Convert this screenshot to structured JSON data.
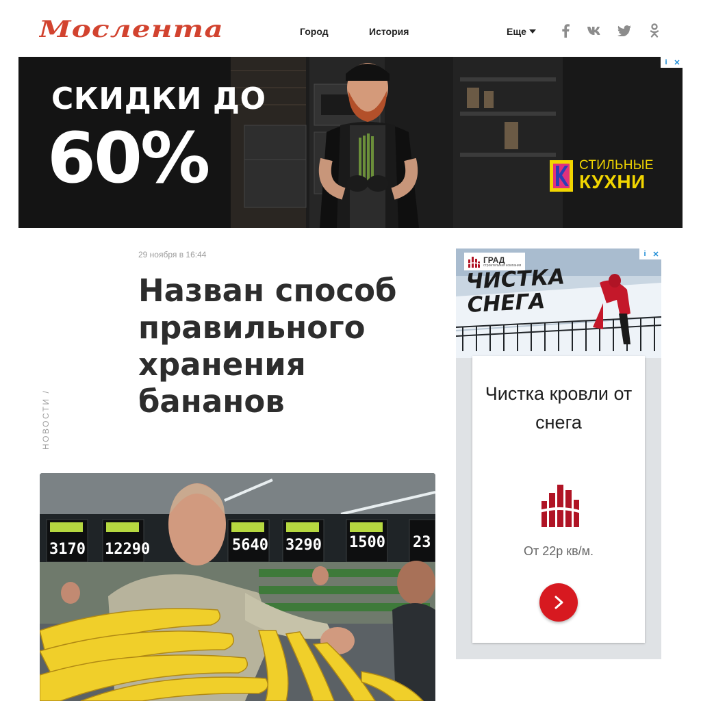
{
  "header": {
    "logo_text": "Мослента",
    "nav": [
      {
        "label": "Город"
      },
      {
        "label": "История"
      }
    ],
    "more_label": "Еще",
    "social_icons": [
      "facebook-icon",
      "vk-icon",
      "twitter-icon",
      "odnoklassniki-icon"
    ],
    "logo_color": "#d2432f"
  },
  "top_banner": {
    "headline": "СКИДКИ ДО",
    "discount": "60%",
    "brand_line1": "СТИЛЬНЫЕ",
    "brand_line2": "КУХНИ",
    "adchoices_icon": "i",
    "close_icon": "✕",
    "brand_color": "#f2d600"
  },
  "article": {
    "date": "29 ноября в 16:44",
    "title": "Назван способ правильного хранения бананов",
    "rubric": "НОВОСТИ /"
  },
  "side_ad": {
    "company": "ГРАД",
    "company_sub": "строительная компания",
    "image_title_line1": "ЧИСТКА",
    "image_title_line2": "СНЕГА",
    "card_title": "Чистка кровли от снега",
    "price": "От 22р кв/м.",
    "adchoices_icon": "i",
    "close_icon": "✕",
    "button_color": "#d71920"
  }
}
